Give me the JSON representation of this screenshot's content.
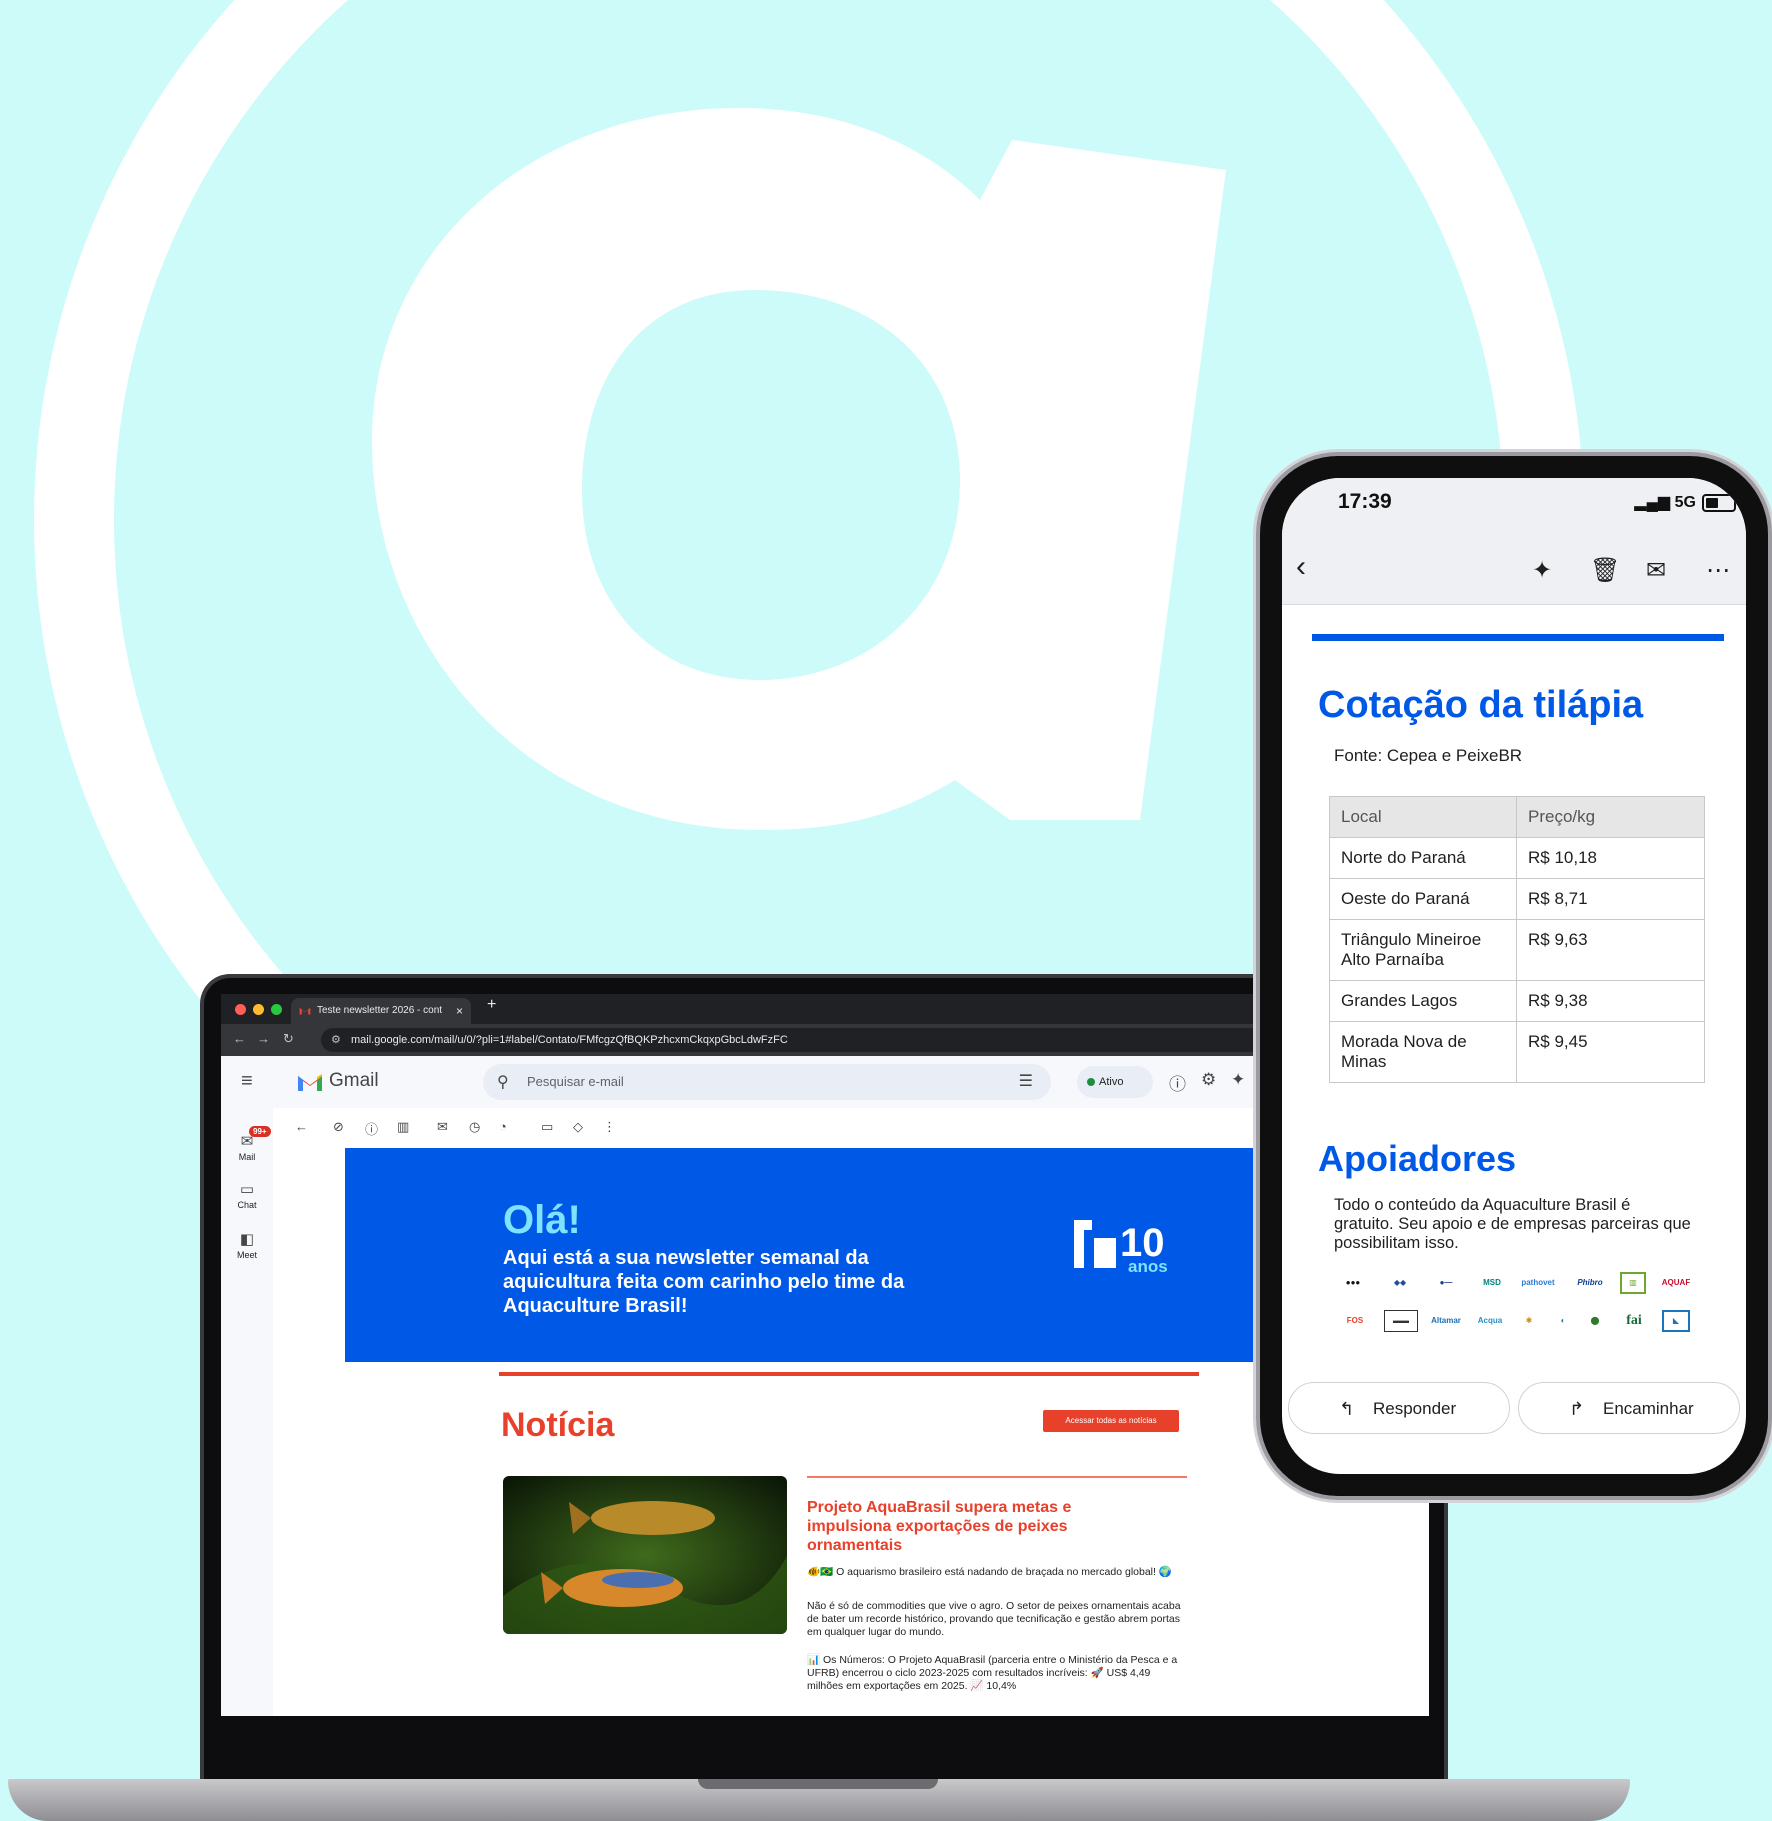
{
  "colors": {
    "brand_blue": "#0058e6",
    "accent_red": "#e8412b",
    "sky": "#7fe3ff",
    "background": "#ccfbf9"
  },
  "browser": {
    "tab_title": "Teste newsletter 2026 - cont",
    "tab_close": "×",
    "new_tab": "+",
    "url": "mail.google.com/mail/u/0/?pli=1#label/Contato/FMfcgzQfBQKPzhcxmCkqxpGbcLdwFzFC"
  },
  "gmail": {
    "brand": "Gmail",
    "search_placeholder": "Pesquisar e-mail",
    "status": "Ativo",
    "rail": {
      "mail": "Mail",
      "mail_badge": "99+",
      "chat": "Chat",
      "meet": "Meet"
    }
  },
  "newsletter": {
    "greeting": "Olá!",
    "intro": "Aqui está a sua newsletter semanal da aquicultura feita com carinho pelo time da Aquaculture Brasil!",
    "logo_number": "10",
    "logo_word": "anos",
    "section": "Notícia",
    "all_news_button": "Acessar todas as notícias",
    "headline": "Projeto AquaBrasil supera metas e impulsiona exportações de peixes ornamentais",
    "p1": "🐠🇧🇷 O aquarismo brasileiro está nadando de braçada no mercado global! 🌍",
    "p2": "Não é só de commodities que vive o agro. O setor de peixes ornamentais acaba de bater um recorde histórico, provando que tecnificação e gestão abrem portas em qualquer lugar do mundo.",
    "p3": "📊 Os Números: O Projeto AquaBrasil (parceria entre o Ministério da Pesca e a UFRB) encerrou o ciclo 2023-2025 com resultados incríveis: 🚀 US$ 4,49 milhões em exportações em 2025. 📈 10,4%"
  },
  "phone": {
    "time": "17:39",
    "network": "5G",
    "title": "Cotação da tilápia",
    "source": "Fonte: Cepea e PeixeBR",
    "table": {
      "headers": [
        "Local",
        "Preço/kg"
      ],
      "rows": [
        [
          "Norte do Paraná",
          "R$ 10,18"
        ],
        [
          "Oeste do Paraná",
          "R$ 8,71"
        ],
        [
          "Triângulo Mineiroe Alto Parnaíba",
          "R$ 9,63"
        ],
        [
          "Grandes Lagos",
          "R$ 9,38"
        ],
        [
          "Morada Nova de Minas",
          "R$ 9,45"
        ]
      ]
    },
    "supporters_title": "Apoiadores",
    "supporters_text": "Todo o conteúdo da Aquaculture Brasil é gratuito. Seu apoio e de empresas parceiras que possibilitam isso.",
    "sponsors_row1": [
      "",
      "",
      "",
      "MSD",
      "pathovet",
      "Phibro",
      "",
      "AQUAF"
    ],
    "sponsors_row2": [
      "FOS",
      "",
      "Altamar",
      "Acqua",
      "",
      "",
      "",
      "fai",
      ""
    ],
    "reply": "Responder",
    "forward": "Encaminhar"
  }
}
